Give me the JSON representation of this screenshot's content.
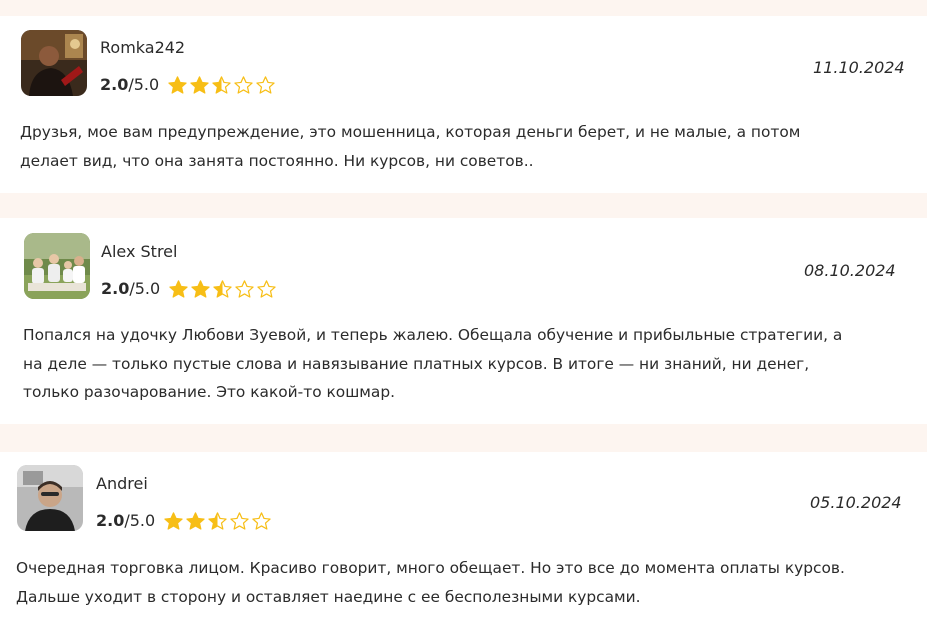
{
  "reviews": [
    {
      "author": "Romka242",
      "score": "2.0",
      "max": "/5.0",
      "rating": 2.5,
      "date": "11.10.2024",
      "avatar_icon": "person-portrait-icon",
      "text_lines": [
        "Друзья, мое вам предупреждение, это мошенница, которая деньги берет, и не малые, а потом",
        "делает вид, что она занята постоянно. Ни курсов, ни советов.."
      ]
    },
    {
      "author": "Alex Strel",
      "score": "2.0",
      "max": "/5.0",
      "rating": 2.5,
      "date": "08.10.2024",
      "avatar_icon": "family-photo-icon",
      "text_lines": [
        "Попался на удочку Любови Зуевой, и теперь жалею. Обещала обучение и прибыльные стратегии, а",
        "на деле — только пустые слова и навязывание платных курсов. В итоге — ни знаний, ни денег,",
        "только разочарование. Это какой-то кошмар."
      ]
    },
    {
      "author": "Andrei",
      "score": "2.0",
      "max": "/5.0",
      "rating": 2.5,
      "date": "05.10.2024",
      "avatar_icon": "man-portrait-icon",
      "text_lines": [
        "Очередная торговка лицом. Красиво говорит, много обещает. Но это все до момента оплаты курсов.",
        "Дальше уходит в сторону и оставляет наедине с ее бесполезными курсами."
      ]
    }
  ],
  "colors": {
    "page_background": "#fdf5f0",
    "card_background": "#ffffff",
    "star_fill": "#f7be16",
    "text": "#2b2b2b"
  }
}
